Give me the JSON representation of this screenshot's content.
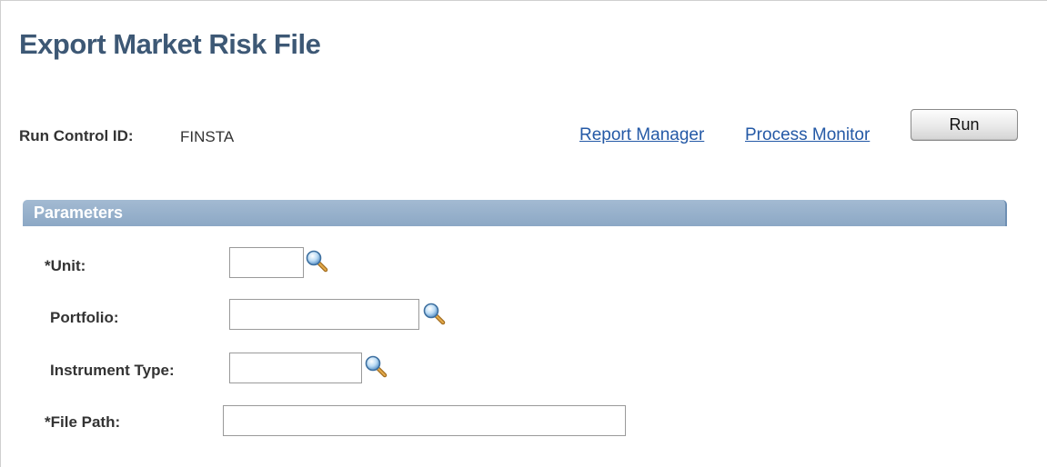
{
  "page": {
    "title": "Export Market Risk File"
  },
  "run_control": {
    "label": "Run Control ID:",
    "value": "FINSTA"
  },
  "links": {
    "report_manager": "Report Manager",
    "process_monitor": "Process Monitor"
  },
  "buttons": {
    "run": "Run"
  },
  "parameters": {
    "section_title": "Parameters",
    "unit": {
      "label": "*Unit:",
      "value": ""
    },
    "portfolio": {
      "label": "Portfolio:",
      "value": ""
    },
    "instrument_type": {
      "label": "Instrument Type:",
      "value": ""
    },
    "file_path": {
      "label": "*File Path:",
      "value": ""
    }
  },
  "icons": {
    "lookup": "magnifying-glass-icon"
  },
  "colors": {
    "title": "#3d5875",
    "link": "#2459a6",
    "section_header": "#8ca8c5",
    "section_text": "#ffffff"
  }
}
